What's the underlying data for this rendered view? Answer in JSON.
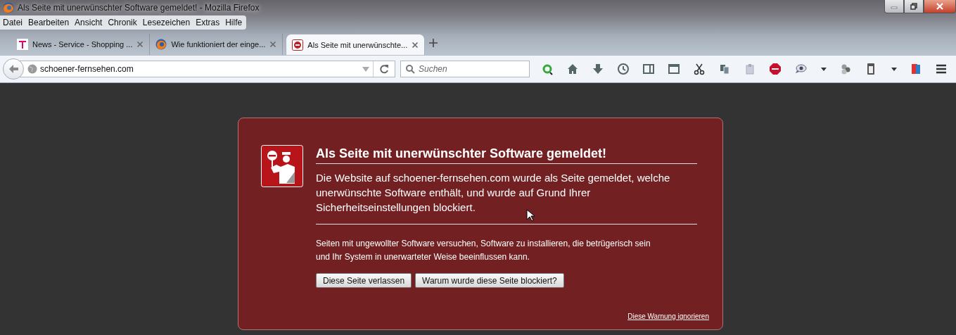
{
  "window": {
    "title": "Als Seite mit unerwünschter Software gemeldet! - Mozilla Firefox"
  },
  "menu": [
    "Datei",
    "Bearbeiten",
    "Ansicht",
    "Chronik",
    "Lesezeichen",
    "Extras",
    "Hilfe"
  ],
  "tabs": [
    {
      "label": "News - Service - Shopping ...",
      "kind": "telekom",
      "selected": false
    },
    {
      "label": "Wie funktioniert der einge...",
      "kind": "firefox",
      "selected": false
    },
    {
      "label": "Als Seite mit unerwünschte...",
      "kind": "blocked",
      "selected": true
    }
  ],
  "address_bar": {
    "value": "schoener-fernsehen.com"
  },
  "search": {
    "placeholder": "Suchen"
  },
  "warning": {
    "title": "Als Seite mit unerwünschter Software gemeldet!",
    "message": "Die Website auf schoener-fernsehen.com wurde als Seite gemeldet, welche unerwünschte Software enthält, und wurde auf Grund Ihrer Sicherheitseinstellungen blockiert.",
    "note": "Seiten mit ungewollter Software versuchen, Software zu installieren, die betrügerisch sein und Ihr System in unerwarteter Weise beeinflussen kann.",
    "buttons": [
      "Diese Seite verlassen",
      "Warum wurde diese Seite blockiert?"
    ],
    "ignore_link": "Diese Warnung ignorieren"
  }
}
